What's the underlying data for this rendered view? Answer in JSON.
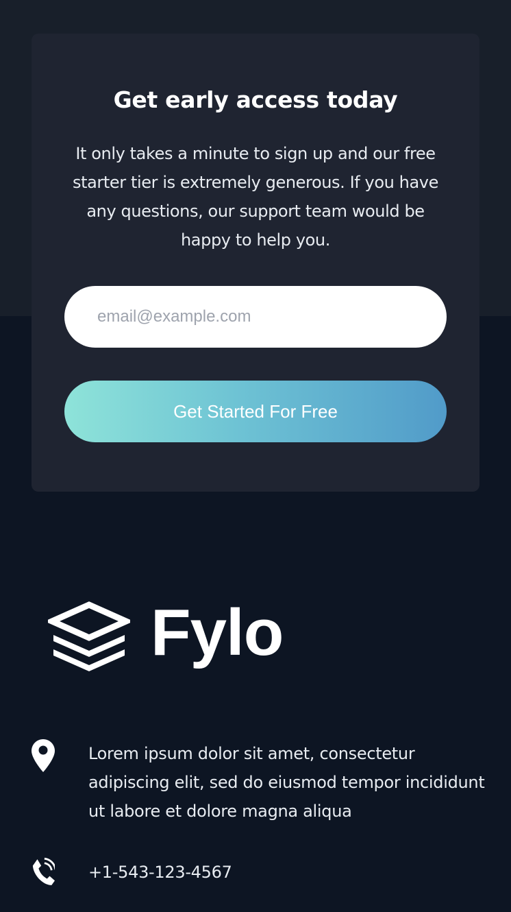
{
  "signup": {
    "title": "Get early access today",
    "description": "It only takes a minute to sign up and our free starter tier is extremely generous. If you have any questions, our support team would be happy to help you.",
    "email_placeholder": "email@example.com",
    "email_value": "",
    "cta_label": "Get Started For Free"
  },
  "footer": {
    "logo_text": "Fylo",
    "logo_icon": "stacked-layers-icon",
    "address_icon": "location-pin-icon",
    "address": "Lorem ipsum dolor sit amet, consectetur adipiscing elit, sed do eiusmod tempor incididunt ut labore et dolore magna aliqua",
    "phone_icon": "phone-icon",
    "phone": "+1-543-123-4567"
  },
  "colors": {
    "page_background": "#0d1523",
    "top_band": "#181f2a",
    "card_background": "#1f2431",
    "cta_gradient_start": "#8ee3d9",
    "cta_gradient_end": "#519bc9"
  }
}
